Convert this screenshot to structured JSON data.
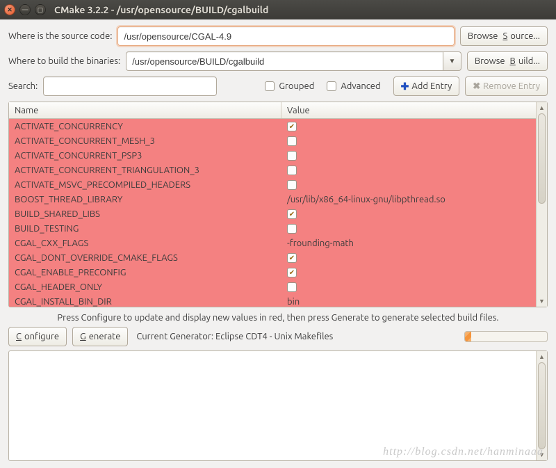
{
  "window": {
    "title": "CMake 3.2.2 - /usr/opensource/BUILD/cgalbuild"
  },
  "fields": {
    "source_label": "Where is the source code:",
    "source_value": "/usr/opensource/CGAL-4.9",
    "browse_source": "Browse Source...",
    "browse_source_ul": "S",
    "build_label": "Where to build the binaries:",
    "build_value": "/usr/opensource/BUILD/cgalbuild",
    "browse_build": "Browse Build...",
    "browse_build_ul": "B",
    "search_label": "Search:",
    "search_value": "",
    "grouped": "Grouped",
    "advanced": "Advanced",
    "add_entry": "Add Entry",
    "remove_entry": "Remove Entry"
  },
  "table": {
    "name_header": "Name",
    "value_header": "Value",
    "rows": [
      {
        "name": "ACTIVATE_CONCURRENCY",
        "type": "bool",
        "checked": true
      },
      {
        "name": "ACTIVATE_CONCURRENT_MESH_3",
        "type": "bool",
        "checked": false
      },
      {
        "name": "ACTIVATE_CONCURRENT_PSP3",
        "type": "bool",
        "checked": false
      },
      {
        "name": "ACTIVATE_CONCURRENT_TRIANGULATION_3",
        "type": "bool",
        "checked": false
      },
      {
        "name": "ACTIVATE_MSVC_PRECOMPILED_HEADERS",
        "type": "bool",
        "checked": false
      },
      {
        "name": "BOOST_THREAD_LIBRARY",
        "type": "text",
        "value": "/usr/lib/x86_64-linux-gnu/libpthread.so"
      },
      {
        "name": "BUILD_SHARED_LIBS",
        "type": "bool",
        "checked": true
      },
      {
        "name": "BUILD_TESTING",
        "type": "bool",
        "checked": false
      },
      {
        "name": "CGAL_CXX_FLAGS",
        "type": "text",
        "value": "-frounding-math"
      },
      {
        "name": "CGAL_DONT_OVERRIDE_CMAKE_FLAGS",
        "type": "bool",
        "checked": true
      },
      {
        "name": "CGAL_ENABLE_PRECONFIG",
        "type": "bool",
        "checked": true
      },
      {
        "name": "CGAL_HEADER_ONLY",
        "type": "bool",
        "checked": false
      },
      {
        "name": "CGAL_INSTALL_BIN_DIR",
        "type": "text",
        "value": "bin"
      }
    ]
  },
  "hint": "Press Configure to update and display new values in red, then press Generate to generate selected build files.",
  "bottom": {
    "configure": "Configure",
    "configure_ul": "C",
    "generate": "Generate",
    "generate_ul": "G",
    "generator_label": "Current Generator: Eclipse CDT4 - Unix Makefiles"
  },
  "watermark": "http://blog.csdn.net/hanminaaa"
}
